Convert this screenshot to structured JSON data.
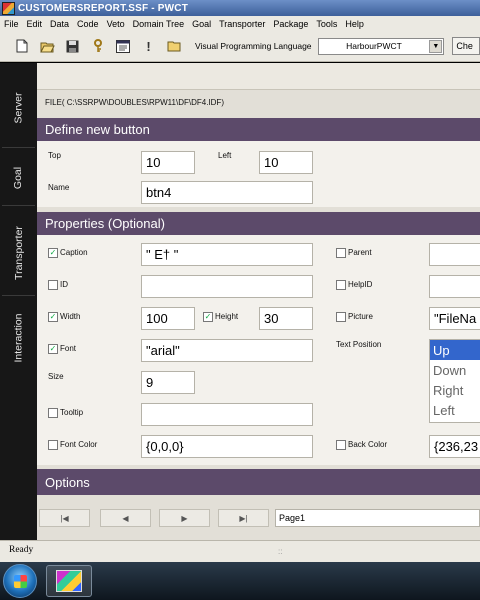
{
  "window": {
    "title": "CUSTOMERSREPORT.SSF - PWCT"
  },
  "menu": [
    "File",
    "Edit",
    "Data",
    "Code",
    "Veto",
    "Domain Tree",
    "Goal",
    "Transporter",
    "Package",
    "Tools",
    "Help"
  ],
  "toolbar": {
    "icons": [
      "new-file-icon",
      "open-folder-icon",
      "save-icon",
      "key-icon",
      "window-icon",
      "exclamation-icon",
      "folder-icon"
    ],
    "vpl_label": "Visual Programming Language",
    "language_value": "HarbourPWCT",
    "cut_button_label": "Che"
  },
  "sidebar": [
    "Server",
    "Goal",
    "Transporter",
    "Interaction"
  ],
  "file_path": "FILE( C:\\SSRPW\\DOUBLES\\RPW11\\DF\\DF4.IDF)",
  "define": {
    "header": "Define new button",
    "top_label": "Top",
    "top_value": "10",
    "left_label": "Left",
    "left_value": "10",
    "name_label": "Name",
    "name_value": "btn4"
  },
  "properties": {
    "header": "Properties (Optional)",
    "caption_label": "Caption",
    "caption_checked": true,
    "caption_value": "\" E† \"",
    "id_label": "ID",
    "id_checked": false,
    "id_value": "",
    "width_label": "Width",
    "width_checked": true,
    "width_value": "100",
    "height_label": "Height",
    "height_checked": true,
    "height_value": "30",
    "font_label": "Font",
    "font_checked": true,
    "font_value": "\"arial\"",
    "size_label": "Size",
    "size_value": "9",
    "tooltip_label": "Tooltip",
    "tooltip_checked": false,
    "tooltip_value": "",
    "fontcolor_label": "Font Color",
    "fontcolor_checked": false,
    "fontcolor_value": "{0,0,0}",
    "parent_label": "Parent",
    "parent_checked": false,
    "parent_value": "",
    "helpid_label": "HelpID",
    "helpid_checked": false,
    "helpid_value": "",
    "picture_label": "Picture",
    "picture_checked": false,
    "picture_value": "\"FileNa",
    "textpos_label": "Text Position",
    "textpos_options": [
      "Up",
      "Down",
      "Right",
      "Left"
    ],
    "textpos_selected": "Up",
    "backcolor_label": "Back Color",
    "backcolor_checked": false,
    "backcolor_value": "{236,23"
  },
  "options": {
    "header": "Options"
  },
  "pager": {
    "first": "first-page-icon",
    "prev": "prev-page-icon",
    "next": "next-page-icon",
    "last": "last-page-icon",
    "page_value": "Page1"
  },
  "status": {
    "text": "Ready",
    "grip": "::"
  },
  "taskbar": {
    "start": "windows-start-icon",
    "app": "pwct-app-icon"
  }
}
